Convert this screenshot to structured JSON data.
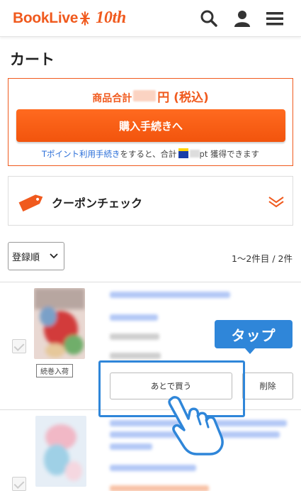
{
  "header": {
    "logo_text": "BookLive",
    "logo_anniversary": "10th",
    "icons": [
      "search-icon",
      "user-icon",
      "menu-icon"
    ],
    "brand_color": "#f05a1e"
  },
  "page": {
    "title": "カート"
  },
  "summary": {
    "total_prefix": "商品合計",
    "total_suffix": "円 (税込)",
    "checkout_label": "購入手続きへ",
    "tpoint_link": "Tポイント利用手続き",
    "tpoint_mid": "をすると、合計",
    "tpoint_suffix": "pt 獲得できます"
  },
  "coupon": {
    "label": "クーポンチェック"
  },
  "list": {
    "sort_value": "登録順",
    "count_text": "1〜2件目 / 2件"
  },
  "items": [
    {
      "badge": "続巻入荷",
      "later_label": "あとで買う",
      "delete_label": "削除"
    }
  ],
  "overlay": {
    "tooltip": "タップ",
    "accent_color": "#2f86d9"
  }
}
